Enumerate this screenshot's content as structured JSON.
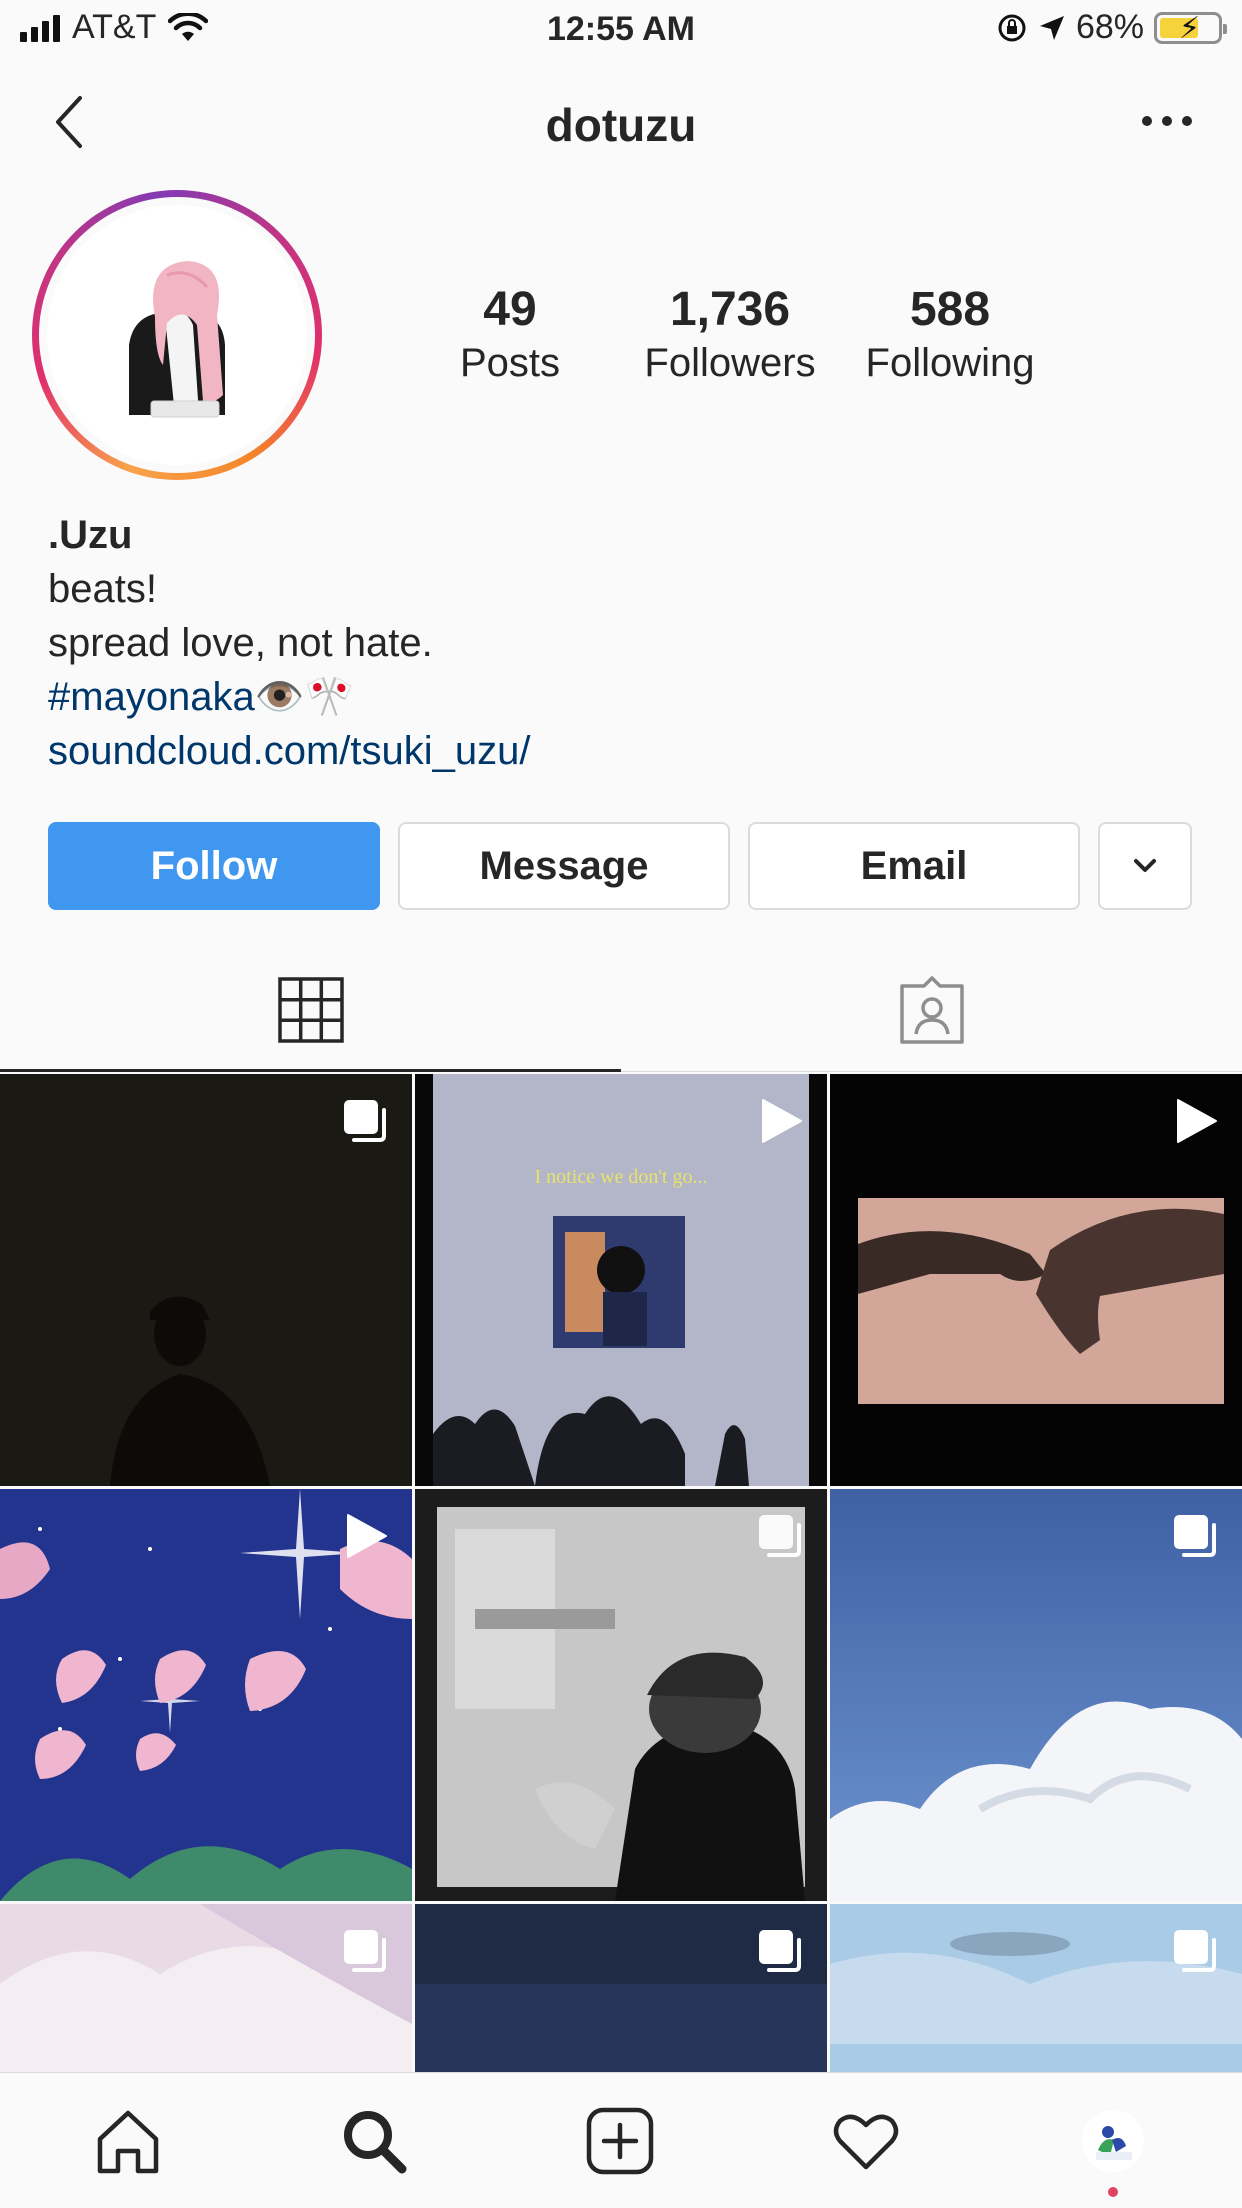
{
  "status_bar": {
    "carrier": "AT&T",
    "time": "12:55 AM",
    "battery_percent": "68%",
    "battery_level": 0.68
  },
  "header": {
    "username": "dotuzu"
  },
  "profile": {
    "stats": [
      {
        "value": "49",
        "label": "Posts"
      },
      {
        "value": "1,736",
        "label": "Followers"
      },
      {
        "value": "588",
        "label": "Following"
      }
    ],
    "name": ".Uzu",
    "bio_line_1": "beats!",
    "bio_line_2": "spread love, not hate.",
    "hashtag": "#mayonaka",
    "hashtag_emoji": "👁️🎌",
    "link": "soundcloud.com/tsuki_uzu/"
  },
  "actions": {
    "follow_label": "Follow",
    "message_label": "Message",
    "email_label": "Email"
  },
  "tabs": [
    {
      "icon": "grid-icon",
      "active": true
    },
    {
      "icon": "tagged-icon",
      "active": false
    }
  ],
  "posts": [
    {
      "id": "silhouette-night",
      "type": "carousel",
      "overlay_text": ""
    },
    {
      "id": "anime-sky",
      "type": "video",
      "overlay_text": "I notice we don't go..."
    },
    {
      "id": "holding-hands",
      "type": "video",
      "overlay_text": ""
    },
    {
      "id": "hearts-stars",
      "type": "video",
      "overlay_text": ""
    },
    {
      "id": "bw-portrait",
      "type": "carousel",
      "overlay_text": ""
    },
    {
      "id": "blue-sky-cloud",
      "type": "carousel",
      "overlay_text": ""
    },
    {
      "id": "pink-clouds",
      "type": "carousel",
      "overlay_text": ""
    },
    {
      "id": "dark-blue-sky",
      "type": "carousel",
      "overlay_text": ""
    },
    {
      "id": "light-sky",
      "type": "carousel",
      "overlay_text": ""
    }
  ],
  "colors": {
    "follow_button": "#3f97f0",
    "link": "#00376b",
    "text": "#262626"
  }
}
